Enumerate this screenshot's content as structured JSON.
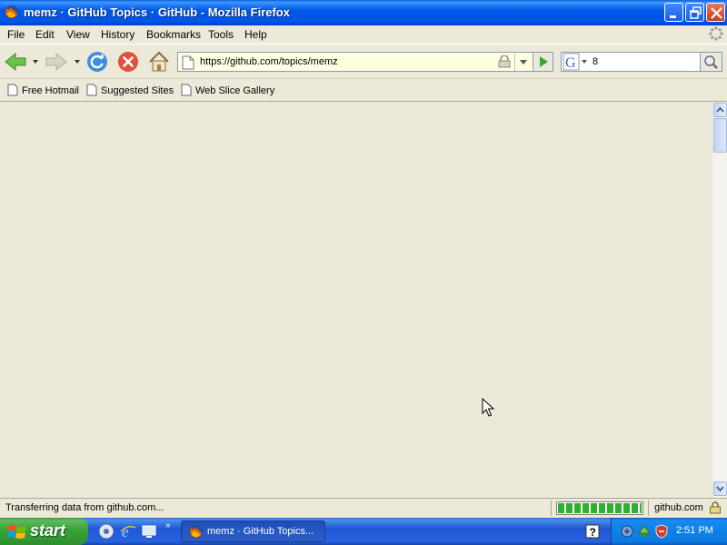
{
  "window": {
    "title": "memz · GitHub Topics · GitHub - Mozilla Firefox"
  },
  "menu": {
    "items": [
      "File",
      "Edit",
      "View",
      "History",
      "Bookmarks",
      "Tools",
      "Help"
    ],
    "underline": [
      "F",
      "E",
      "V",
      "S",
      "B",
      "T",
      "H"
    ]
  },
  "nav": {
    "url": "https://github.com/topics/memz",
    "search_value": "8",
    "search_engine_icon": "google-icon"
  },
  "bookmarks": {
    "items": [
      "Free Hotmail",
      "Suggested Sites",
      "Web Slice Gallery"
    ]
  },
  "status": {
    "text": "Transferring data from github.com...",
    "host": "github.com",
    "progress_segments": 10,
    "progress_fraction": 1.0
  },
  "taskbar": {
    "start_label": "start",
    "task_button_label": "memz · GitHub Topics...",
    "clock": "2:51 PM"
  },
  "colors": {
    "titlebar": "#0055E5",
    "urlbar_bg": "#FFFFE1",
    "content_bg": "#ECE9D8",
    "progress": "#2DB12D",
    "start_green": "#37A337",
    "taskbar": "#2157D7"
  }
}
